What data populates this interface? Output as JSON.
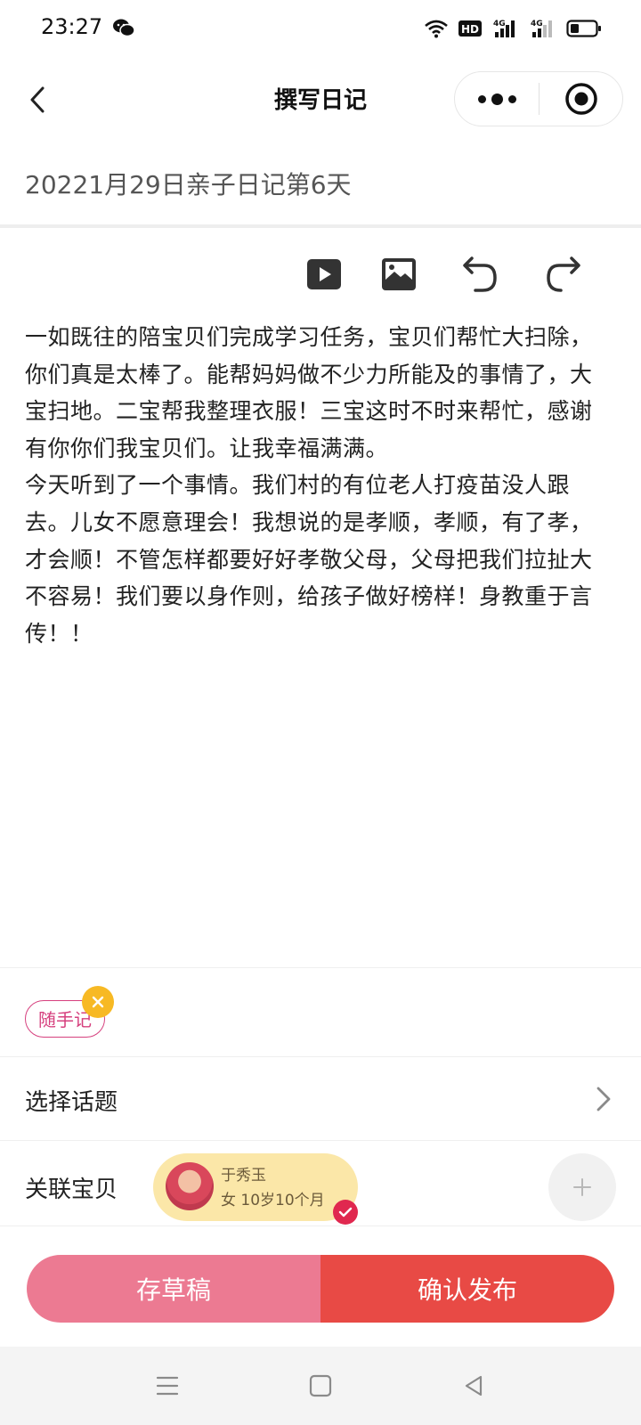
{
  "status_bar": {
    "time": "23:27",
    "icons": [
      "wechat-icon",
      "wifi-icon",
      "hd-icon",
      "4g-signal-icon",
      "4g-signal-icon",
      "battery-icon"
    ]
  },
  "nav": {
    "title": "撰写日记",
    "more_icon": "more-dots-icon",
    "close_icon": "target-icon"
  },
  "editor": {
    "title_value": "20221月29日亲子日记第6天",
    "toolbar": [
      "video-icon",
      "image-icon",
      "undo-icon",
      "redo-icon"
    ],
    "content": [
      "一如既往的陪宝贝们完成学习任务，宝贝们帮忙大扫除，你们真是太棒了。能帮妈妈做不少力所能及的事情了，大宝扫地。二宝帮我整理衣服！三宝这时不时来帮忙，感谢有你你们我宝贝们。让我幸福满满。",
      "今天听到了一个事情。我们村的有位老人打疫苗没人跟去。儿女不愿意理会！我想说的是孝顺，孝顺，有了孝，才会顺！不管怎样都要好好孝敬父母，父母把我们拉扯大不容易！我们要以身作则，给孩子做好榜样！身教重于言传！！"
    ]
  },
  "tags": {
    "items": [
      "随手记"
    ]
  },
  "topic": {
    "label": "选择话题"
  },
  "baby": {
    "label": "关联宝贝",
    "name": "于秀玉",
    "info": "女  10岁10个月"
  },
  "actions": {
    "draft_label": "存草稿",
    "publish_label": "确认发布"
  },
  "colors": {
    "draft": "#ec7a92",
    "publish": "#e84a45",
    "tag": "#d6407e",
    "baby_chip": "#fbe7a8"
  }
}
